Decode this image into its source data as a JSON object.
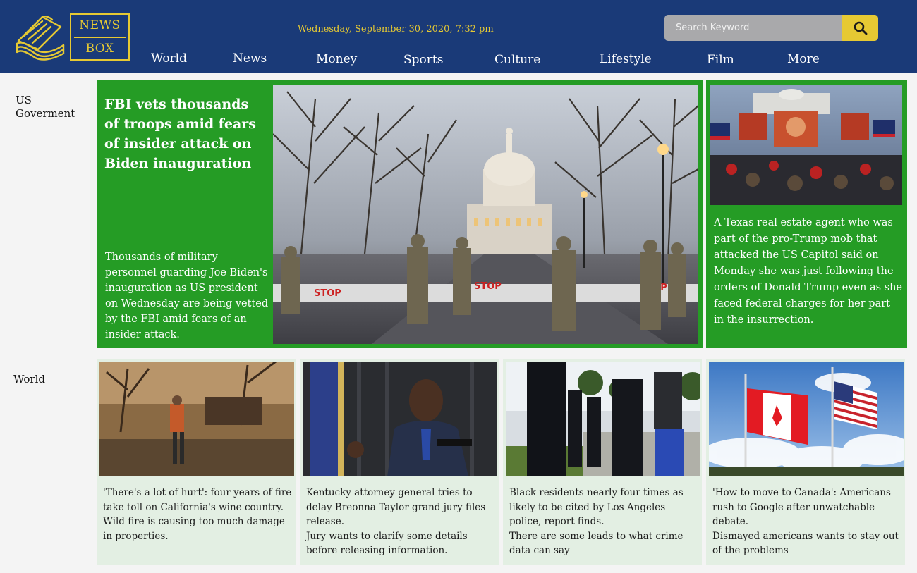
{
  "header": {
    "brand_line1": "NEWS",
    "brand_line2": "BOX",
    "date": "Wednesday, September 30, 2020, 7:32 pm",
    "search_placeholder": "Search Keyword",
    "nav": [
      "World",
      "News",
      "Money",
      "Sports",
      "Culture",
      "Lifestyle",
      "Film",
      "More"
    ]
  },
  "sections": {
    "us_government": "US Goverment",
    "world": "World"
  },
  "hero": {
    "title": "FBI vets thousands of troops amid fears of insider attack on Biden inauguration",
    "summary": "Thousands of military personnel guarding Joe Biden's inauguration as US president on Wednesday are being vetted by the FBI amid fears of an insider attack."
  },
  "side_story": {
    "text": "A Texas real estate agent who was part of the pro-Trump mob that attacked the US Capitol said on Monday she was just following the orders of Donald Trump even as she faced federal charges for her part in the insurrection."
  },
  "world_cards": [
    {
      "headline": "'There's a lot of hurt': four years of fire take toll on California's wine country.",
      "summary": "Wild fire is causing too much damage in properties."
    },
    {
      "headline": "Kentucky attorney general tries to delay Breonna Taylor grand jury files release.",
      "summary": "Jury wants to clarify some details before releasing information."
    },
    {
      "headline": "Black residents nearly four times as likely to be cited by Los Angeles police, report finds.",
      "summary": "There are some leads to what crime data can say"
    },
    {
      "headline": "'How to move to Canada': Americans rush to Google after unwatchable debate.",
      "summary": "Dismayed americans wants to stay out of the problems"
    }
  ],
  "colors": {
    "header_bg": "#1a3a78",
    "accent_yellow": "#e6c933",
    "feature_green": "#259c25",
    "card_bg": "#e3efe3"
  }
}
